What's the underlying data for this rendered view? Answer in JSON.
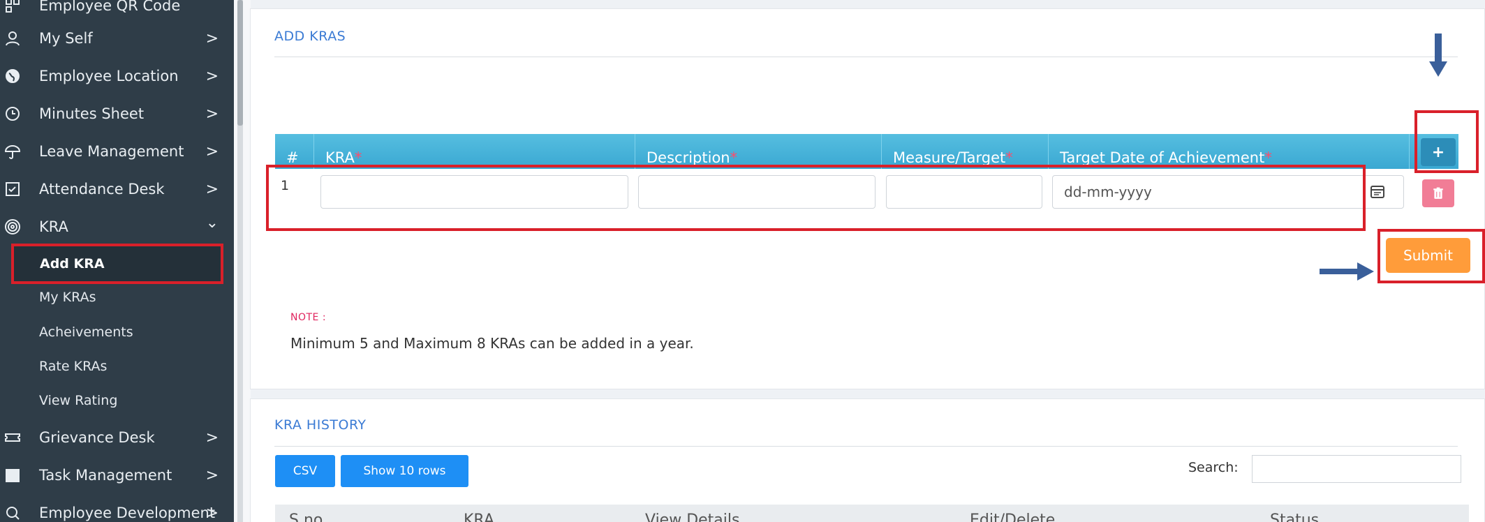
{
  "sidebar": {
    "items": [
      {
        "label": "Employee QR Code",
        "icon": "qr-code-icon"
      },
      {
        "label": "My Self",
        "icon": "user-icon"
      },
      {
        "label": "Employee Location",
        "icon": "globe-icon"
      },
      {
        "label": "Minutes Sheet",
        "icon": "clock-icon"
      },
      {
        "label": "Leave Management",
        "icon": "umbrella-icon"
      },
      {
        "label": "Attendance Desk",
        "icon": "checkbox-icon"
      },
      {
        "label": "KRA",
        "icon": "target-icon"
      },
      {
        "label": "Grievance Desk",
        "icon": "ticket-icon"
      },
      {
        "label": "Task Management",
        "icon": "server-icon"
      },
      {
        "label": "Employee Development",
        "icon": "search-icon"
      }
    ],
    "kra_sub": [
      "Add KRA",
      "My KRAs",
      "Acheivements",
      "Rate KRAs",
      "View Rating"
    ],
    "chevron_right": ">",
    "chevron_down": "⌄"
  },
  "add_kras": {
    "title": "ADD KRAS",
    "columns": [
      "#",
      "KRA",
      "Description",
      "Measure/Target",
      "Target Date of Achievement"
    ],
    "required_mark": "*",
    "row": {
      "number": "1",
      "date_placeholder": "dd-mm-yyyy"
    },
    "add_label": "+",
    "submit_label": "Submit",
    "note_label": "NOTE :",
    "note_text": "Minimum 5 and Maximum 8 KRAs can be added in a year."
  },
  "kra_history": {
    "title": "KRA HISTORY",
    "csv_label": "CSV",
    "show_rows_label": "Show 10 rows",
    "search_label": "Search:",
    "columns": [
      "S.no",
      "KRA",
      "View Details",
      "Edit/Delete",
      "Status"
    ]
  },
  "colors": {
    "sidebar_bg": "#2f3d48",
    "table_header": "#3aa8d2",
    "submit": "#ff9c3a",
    "delete": "#f17d96",
    "highlight": "#d9202a",
    "arrow": "#3a5f9a"
  }
}
